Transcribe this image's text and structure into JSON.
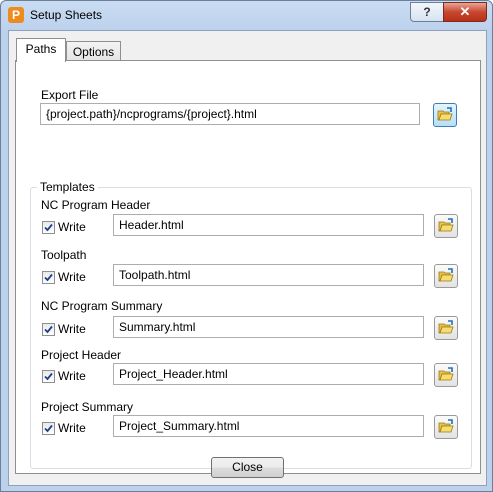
{
  "window": {
    "title": "Setup Sheets",
    "app_icon_letter": "P",
    "help_label": "?",
    "close_label": "✕"
  },
  "tabs": [
    {
      "label": "Paths",
      "selected": true
    },
    {
      "label": "Options",
      "selected": false
    }
  ],
  "export_file": {
    "label": "Export File",
    "value": "{project.path}/ncprograms/{project}.html"
  },
  "templates": {
    "group_label": "Templates",
    "items": [
      {
        "label": "NC Program Header",
        "write_label": "Write",
        "checked": true,
        "value": "Header.html"
      },
      {
        "label": "Toolpath",
        "write_label": "Write",
        "checked": true,
        "value": "Toolpath.html"
      },
      {
        "label": "NC Program Summary",
        "write_label": "Write",
        "checked": true,
        "value": "Summary.html"
      },
      {
        "label": "Project Header",
        "write_label": "Write",
        "checked": true,
        "value": "Project_Header.html"
      },
      {
        "label": "Project Summary",
        "write_label": "Write",
        "checked": true,
        "value": "Project_Summary.html"
      }
    ]
  },
  "footer": {
    "close_button_label": "Close"
  }
}
